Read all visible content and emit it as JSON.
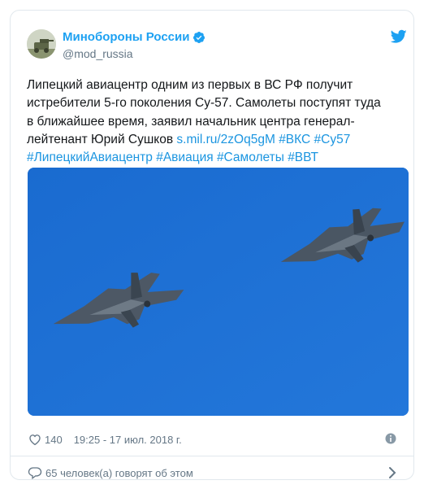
{
  "tweet": {
    "author": {
      "display_name": "Минобороны России",
      "handle": "@mod_russia"
    },
    "text": {
      "line1": "Липецкий авиацентр одним из первых в ВС РФ получит",
      "line2": "истребители 5-го поколения Су-57. Самолеты поступят туда",
      "line3": "в ближайшее время, заявил начальник центра генерал-",
      "line4": "лейтенант Юрий Сушков",
      "link": "s.mil.ru/2zOq5gM",
      "hashtag1": "#ВКС",
      "hashtag2": "#Су57",
      "hashtag3": "#ЛипецкийАвиацентр",
      "hashtag4": "#Авиация",
      "hashtag5": "#Самолеты",
      "hashtag6": "#ВВТ"
    },
    "likes": "140",
    "timestamp": "19:25 - 17 июл. 2018 г.",
    "footer": "65 человек(а) говорят об этом"
  },
  "colors": {
    "accent": "#1da1f2",
    "link": "#1b95e0",
    "muted": "#657786",
    "sky": "#1d6fd2"
  },
  "icons": [
    "avatar",
    "verified-icon",
    "twitter-bird-icon",
    "heart-icon",
    "info-icon",
    "comment-icon",
    "chevron-right-icon"
  ]
}
